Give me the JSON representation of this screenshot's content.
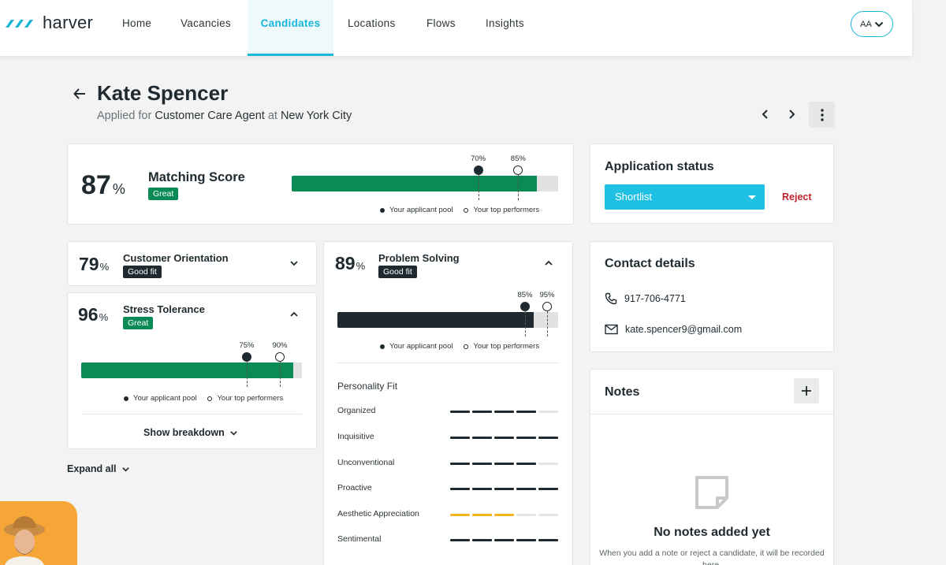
{
  "brand": {
    "name": "harver",
    "accent": "#18b6d8",
    "green": "#0a8a55"
  },
  "nav": {
    "items": [
      {
        "label": "Home"
      },
      {
        "label": "Vacancies"
      },
      {
        "label": "Candidates",
        "active": true
      },
      {
        "label": "Locations"
      },
      {
        "label": "Flows"
      },
      {
        "label": "Insights"
      }
    ],
    "user_initials": "AA"
  },
  "header": {
    "name": "Kate Spencer",
    "applied_prefix": "Applied for",
    "role": "Customer Care Agent",
    "at": "at",
    "location": "New York City"
  },
  "matching": {
    "score": "87",
    "pct": "%",
    "title": "Matching Score",
    "badge": "Great",
    "fill": 0.92,
    "pool_value": 0.7,
    "pool_label": "70%",
    "top_value": 0.85,
    "top_label": "85%",
    "legend_pool": "Your applicant pool",
    "legend_top": "Your top performers"
  },
  "customer_orientation": {
    "score": "79",
    "pct": "%",
    "title": "Customer Orientation",
    "badge": "Good fit"
  },
  "stress_tolerance": {
    "score": "96",
    "pct": "%",
    "title": "Stress Tolerance",
    "badge": "Great",
    "fill": 0.96,
    "pool_value": 0.75,
    "pool_label": "75%",
    "top_value": 0.9,
    "top_label": "90%",
    "legend_pool": "Your applicant pool",
    "legend_top": "Your top performers",
    "show_breakdown": "Show breakdown"
  },
  "expand_all": "Expand all",
  "problem_solving": {
    "score": "89",
    "pct": "%",
    "title": "Problem Solving",
    "badge": "Good fit",
    "fill": 0.89,
    "pool_value": 0.85,
    "pool_label": "85%",
    "top_value": 0.95,
    "top_label": "95%",
    "legend_pool": "Your applicant pool",
    "legend_top": "Your top performers"
  },
  "personality": {
    "title": "Personality Fit",
    "traits": [
      {
        "label": "Organized",
        "level": 4,
        "color": "#1f2a30"
      },
      {
        "label": "Inquisitive",
        "level": 5,
        "color": "#1f2a30"
      },
      {
        "label": "Unconventional",
        "level": 4,
        "color": "#1f2a30"
      },
      {
        "label": "Proactive",
        "level": 5,
        "color": "#1f2a30"
      },
      {
        "label": "Aesthetic Appreciation",
        "level": 3,
        "color": "#f2b521"
      },
      {
        "label": "Sentimental",
        "level": 5,
        "color": "#1f2a30"
      }
    ]
  },
  "application_status": {
    "title": "Application status",
    "selected": "Shortlist",
    "reject": "Reject"
  },
  "contact": {
    "title": "Contact details",
    "phone": "917-706-4771",
    "email": "kate.spencer9@gmail.com"
  },
  "notes": {
    "title": "Notes",
    "empty_title": "No notes added yet",
    "empty_desc": "When you add a note or reject a candidate, it will be recorded here."
  }
}
